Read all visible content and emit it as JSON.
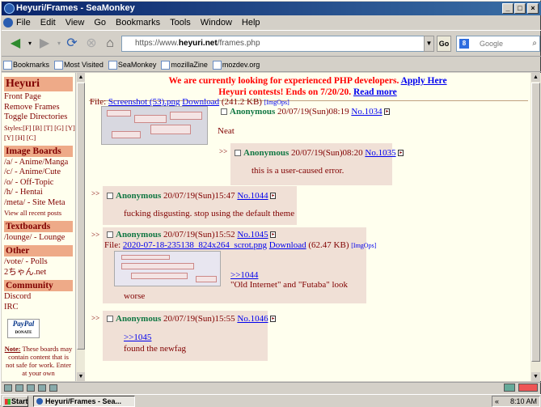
{
  "window": {
    "title": "Heyuri/Frames - SeaMonkey"
  },
  "menu": [
    "File",
    "Edit",
    "View",
    "Go",
    "Bookmarks",
    "Tools",
    "Window",
    "Help"
  ],
  "nav": {
    "url_prefix": "https://www.",
    "url_host": "heyuri.net",
    "url_path": "/frames.php",
    "go_label": "Go",
    "search_placeholder": "Google"
  },
  "bookmarks": [
    "Bookmarks",
    "Most Visited",
    "SeaMonkey",
    "mozillaZine",
    "mozdev.org"
  ],
  "sidebar": {
    "site_title": "Heyuri",
    "links": [
      "Front Page",
      "Remove Frames",
      "Toggle Directories"
    ],
    "styles_line1": "Styles:[F] [B] [T] [G] [Y]",
    "styles_line2": "[Y] [H] [C]",
    "image_boards_title": "Image Boards",
    "image_boards": [
      "/a/ - Anime/Manga",
      "/c/ - Anime/Cute",
      "/o/ - Off-Topic",
      "/h/ - Hentai",
      "/meta/ - Site Meta"
    ],
    "view_all": "View all recent posts",
    "textboards_title": "Textboards",
    "textboards": [
      "/lounge/ - Lounge"
    ],
    "other_title": "Other",
    "other": [
      "/vote/ - Polls",
      "2ちゃん.net"
    ],
    "community_title": "Community",
    "community": [
      "Discord",
      "IRC"
    ],
    "paypal_label": "PayPal",
    "paypal_sub": "DONATE",
    "note_label": "Note:",
    "note_text": " These boards may contain content that is not safe for work. Enter at your own"
  },
  "banner": {
    "line1_text": "We are currently looking for experienced PHP developers. ",
    "line1_link": "Apply Here",
    "line2_text": "Heyuri contests! Ends on 7/20/20. ",
    "line2_link": "Read more"
  },
  "op": {
    "file_label": "File: ",
    "file_name": "Screenshot (53).png",
    "download": "Download",
    "file_meta": " (241.2 KB) ",
    "imgops": "[ImgOps]",
    "name": "Anonymous",
    "date": " 20/07/19(Sun)08:19 ",
    "no": "No.1034",
    "body": "Neat"
  },
  "posts": [
    {
      "name": "Anonymous",
      "date": " 20/07/19(Sun)08:20 ",
      "no": "No.1035",
      "body": "this is a user-caused error."
    },
    {
      "name": "Anonymous",
      "date": " 20/07/19(Sun)15:47 ",
      "no": "No.1044",
      "body": "fucking disgusting. stop using the default theme"
    },
    {
      "name": "Anonymous",
      "date": " 20/07/19(Sun)15:52 ",
      "no": "No.1045",
      "file_label": "File: ",
      "file_name": "2020-07-18-235138_824x264_scrot.png",
      "download": "Download",
      "file_meta": " (62.47 KB) ",
      "imgops": "[ImgOps]",
      "quote": ">>1044",
      "body1": "\"Old Internet\" and \"Futaba\" look",
      "body2": "worse"
    },
    {
      "name": "Anonymous",
      "date": " 20/07/19(Sun)15:55 ",
      "no": "No.1046",
      "quote": ">>1045",
      "body": "found the newfag"
    }
  ],
  "reply_marker": ">>",
  "taskbar": {
    "start": "Start",
    "item": "Heyuri/Frames - Sea...",
    "time": "8:10 AM"
  }
}
